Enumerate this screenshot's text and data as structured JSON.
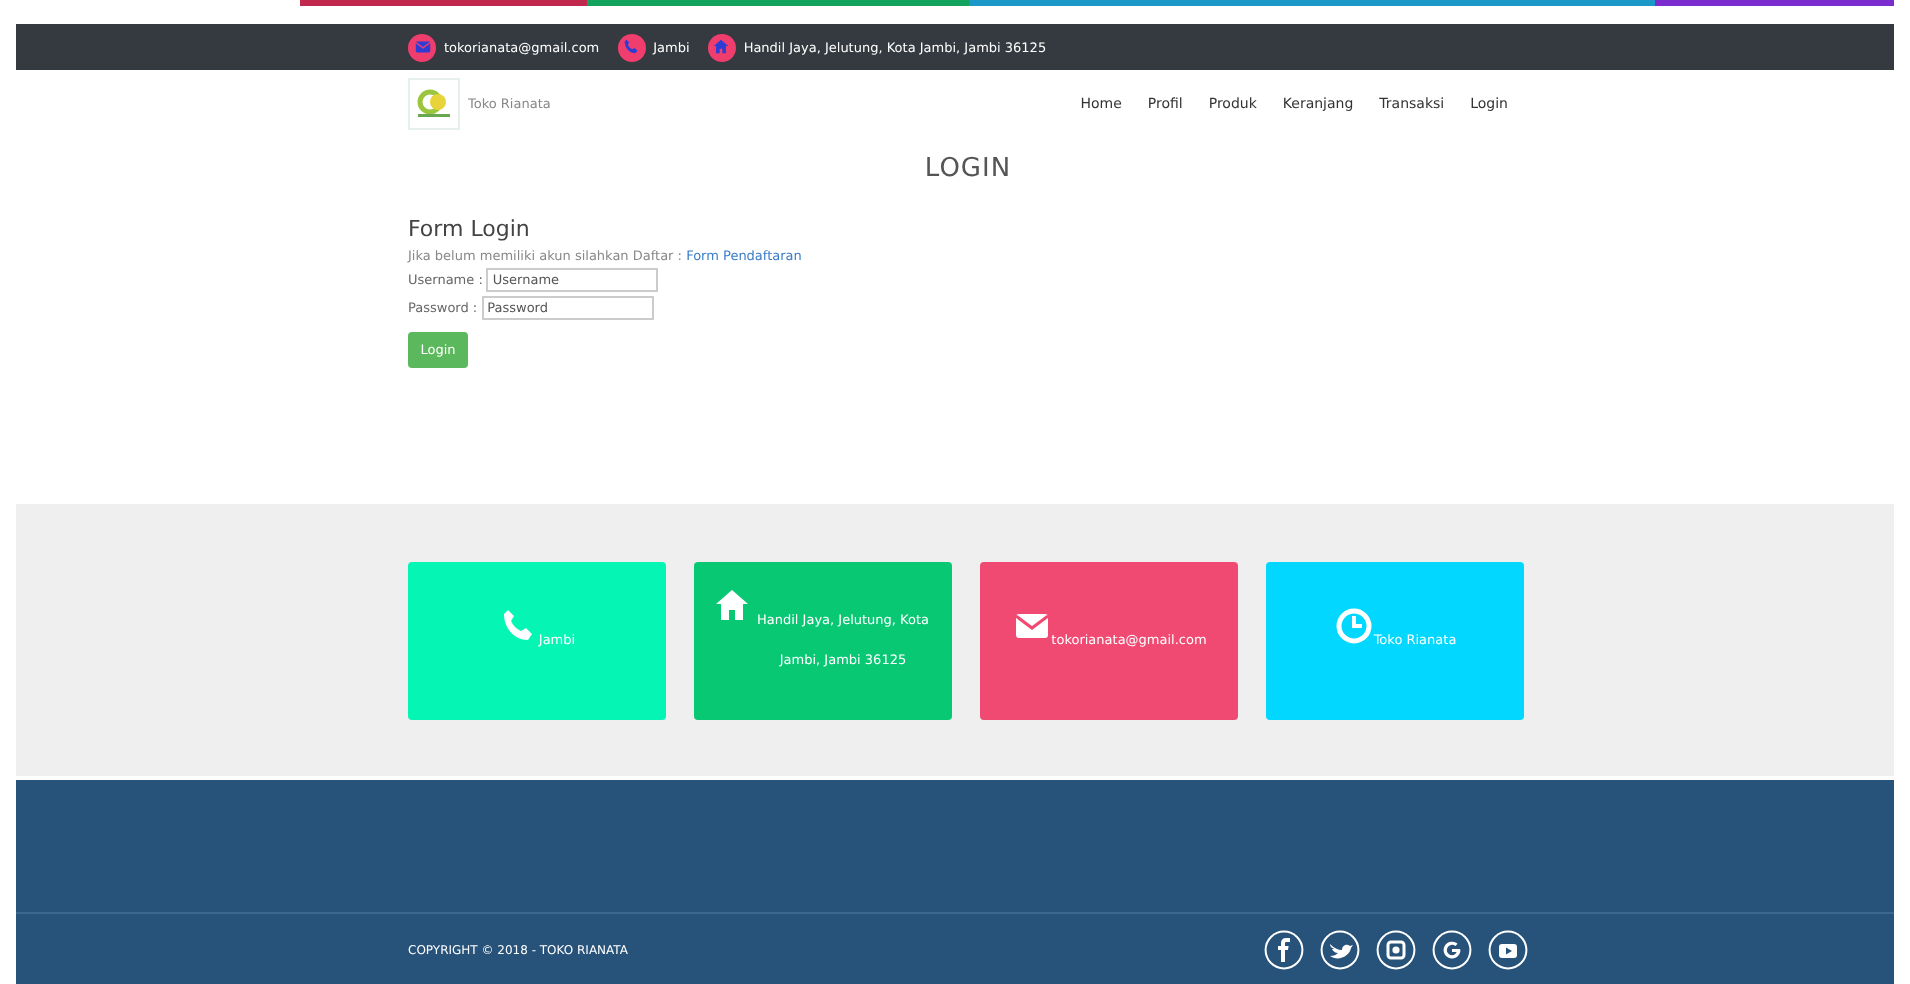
{
  "topbar": {
    "contacts": [
      {
        "kind": "mail",
        "text": "tokorianata@gmail.com"
      },
      {
        "kind": "phone",
        "text": "Jambi"
      },
      {
        "kind": "home",
        "text": "Handil Jaya, Jelutung, Kota Jambi, Jambi 36125"
      }
    ]
  },
  "brand": {
    "name": "Toko Rianata"
  },
  "nav": {
    "items": [
      "Home",
      "Profil",
      "Produk",
      "Keranjang",
      "Transaksi",
      "Login"
    ]
  },
  "page_title": "LOGIN",
  "form": {
    "title": "Form Login",
    "hint": "Jika belum memiliki akun silahkan Daftar : ",
    "hint_link": "Form Pendaftaran",
    "fields": [
      {
        "label": "Username :",
        "placeholder": "Username"
      },
      {
        "label": "Password :",
        "placeholder": "Password"
      }
    ],
    "button": "Login"
  },
  "cards": [
    {
      "kind": "phone",
      "color": "#05f5b5",
      "text": "Jambi"
    },
    {
      "kind": "home",
      "color": "#08c874",
      "text": "Handil Jaya, Jelutung, Kota Jambi, Jambi 36125"
    },
    {
      "kind": "mail",
      "color": "#f04a72",
      "text": "tokorianata@gmail.com"
    },
    {
      "kind": "clock",
      "color": "#02d8ff",
      "text": "Toko Rianata"
    }
  ],
  "footer": {
    "copyright": "COPYRIGHT © 2018 - TOKO RIANATA",
    "social": [
      {
        "kind": "facebook"
      },
      {
        "kind": "twitter"
      },
      {
        "kind": "instagram"
      },
      {
        "kind": "google"
      },
      {
        "kind": "youtube"
      }
    ]
  }
}
